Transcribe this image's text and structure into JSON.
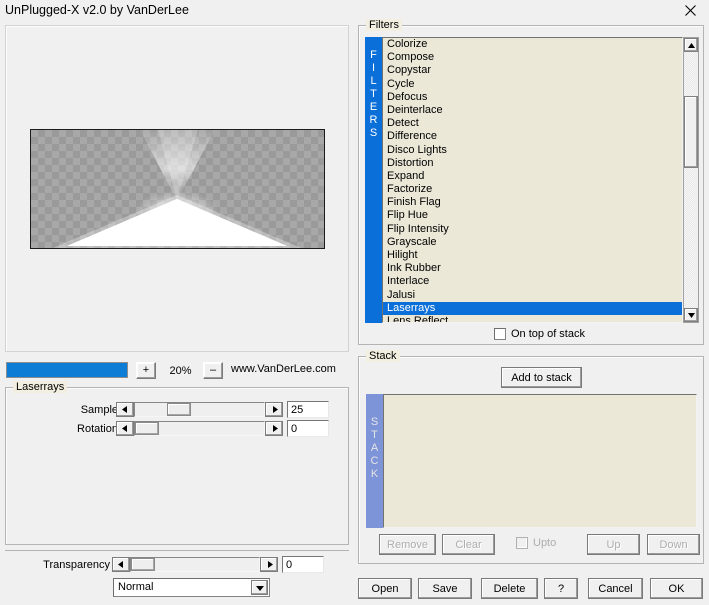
{
  "window": {
    "title": "UnPlugged-X v2.0 by VanDerLee",
    "close_label": "close-icon"
  },
  "preview": {
    "name": "filter-preview",
    "description": "checkerboard transparency preview with white laserrays triangle"
  },
  "zoom_row": {
    "progress_percent": 100,
    "plus_label": "+",
    "zoom_level": "20%",
    "minus_label": "–",
    "website": "www.VanDerLee.com"
  },
  "params": {
    "group_title": "Laserrays",
    "rows": [
      {
        "label": "Sample",
        "value": "25",
        "thumb_percent": 26
      },
      {
        "label": "Rotation",
        "value": "0",
        "thumb_percent": 0
      }
    ]
  },
  "transparency": {
    "label": "Transparency",
    "value": "0",
    "thumb_percent": 0,
    "blend_mode": "Normal"
  },
  "filters": {
    "group_title": "Filters",
    "band_label": "FILTERS",
    "selected": "Laserrays",
    "items": [
      "Colorize",
      "Compose",
      "Copystar",
      "Cycle",
      "Defocus",
      "Deinterlace",
      "Detect",
      "Difference",
      "Disco Lights",
      "Distortion",
      "Expand",
      "Factorize",
      "Finish Flag",
      "Flip Hue",
      "Flip Intensity",
      "Grayscale",
      "Hilight",
      "Ink Rubber",
      "Interlace",
      "Jalusi",
      "Laserrays",
      "Lens Reflect"
    ],
    "on_top_of_stack_label": "On top of stack",
    "on_top_of_stack_checked": false
  },
  "stack": {
    "group_title": "Stack",
    "band_label": "STACK",
    "add_button": "Add to stack",
    "items": [],
    "remove_label": "Remove",
    "clear_label": "Clear",
    "upto_label": "Upto",
    "upto_checked": false,
    "up_label": "Up",
    "down_label": "Down"
  },
  "bottom_buttons": [
    {
      "label": "Open",
      "name": "open-button"
    },
    {
      "label": "Save",
      "name": "save-button"
    },
    {
      "label": "Delete",
      "name": "delete-button"
    },
    {
      "label": "?",
      "name": "help-button"
    },
    {
      "label": "Cancel",
      "name": "cancel-button"
    },
    {
      "label": "OK",
      "name": "ok-button"
    }
  ],
  "colors": {
    "accent_blue": "#0a6fd8",
    "stack_band_blue": "#7d94d8",
    "list_background": "#ebe8d8",
    "window_background": "#f0f0f0",
    "disabled_text": "#adadad"
  }
}
